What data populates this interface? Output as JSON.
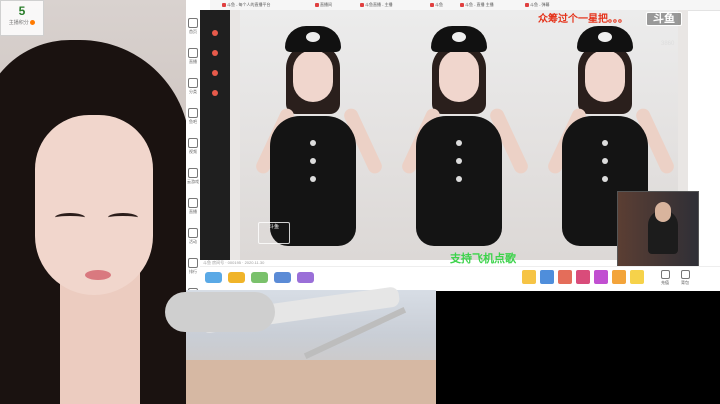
{
  "follower": {
    "count": "5",
    "label": "主播积分"
  },
  "sidebar": {
    "items": [
      {
        "label": "首页"
      },
      {
        "label": "直播"
      },
      {
        "label": "分类"
      },
      {
        "label": "鱼吧"
      },
      {
        "label": "视频"
      },
      {
        "label": "云游戏"
      },
      {
        "label": "直播"
      },
      {
        "label": "活动"
      },
      {
        "label": "排行"
      },
      {
        "label": "WEB"
      }
    ]
  },
  "browser": {
    "tabs": [
      {
        "label": "斗鱼 - 每个人的直播平台"
      },
      {
        "label": "直播间"
      },
      {
        "label": "斗鱼直播 - 主播"
      },
      {
        "label": "斗鱼"
      },
      {
        "label": "斗鱼 - 直播 主播"
      },
      {
        "label": "斗鱼 - 弹幕"
      }
    ]
  },
  "video": {
    "overlay_text": "众筹过个一星把。。。",
    "logo": "斗鱼",
    "room_id": "3860",
    "watermark": "斗鱼",
    "caption": "支持飞机点歌",
    "meta": "斗鱼 房间号 · 000195 · 2020.11.30"
  },
  "toolbar": {
    "tools": [
      {
        "label": "充值"
      },
      {
        "label": "背包"
      }
    ]
  },
  "colors": {
    "overlay_text": "#e5331b",
    "caption": "#3cd34b",
    "follower_count": "#2a7d2a"
  }
}
